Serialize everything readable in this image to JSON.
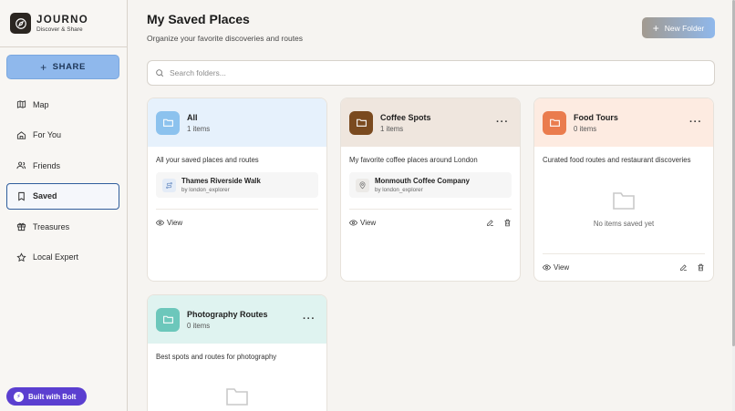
{
  "brand": {
    "name": "JOURNO",
    "tagline": "Discover & Share"
  },
  "sidebar": {
    "share_label": "SHARE",
    "items": [
      {
        "label": "Map",
        "icon": "map-icon"
      },
      {
        "label": "For You",
        "icon": "home-icon"
      },
      {
        "label": "Friends",
        "icon": "users-icon"
      },
      {
        "label": "Saved",
        "icon": "bookmark-icon",
        "active": true
      },
      {
        "label": "Treasures",
        "icon": "gift-icon"
      },
      {
        "label": "Local Expert",
        "icon": "star-icon"
      }
    ],
    "bolt_label": "Built with Bolt"
  },
  "main": {
    "title": "My Saved Places",
    "subtitle": "Organize your favorite discoveries and routes",
    "new_folder_label": "New Folder",
    "search_placeholder": "Search folders..."
  },
  "colors": {
    "all_head": "#e6f1fc",
    "all_icon": "#8cc2ee",
    "coffee_head": "#efe6de",
    "coffee_icon": "#7a4a1f",
    "food_head": "#fdebe1",
    "food_icon": "#ea7c4e",
    "photo_head": "#dff3f0",
    "photo_icon": "#6cc7bb"
  },
  "folders": [
    {
      "name": "All",
      "count": "1 items",
      "description": "All your saved places and routes",
      "item": {
        "title": "Thames Riverside Walk",
        "by": "by london_explorer",
        "icon": "route-icon"
      },
      "view_label": "View"
    },
    {
      "name": "Coffee Spots",
      "count": "1 items",
      "description": "My favorite coffee places around London",
      "item": {
        "title": "Monmouth Coffee Company",
        "by": "by london_explorer",
        "icon": "map-pin-icon"
      },
      "view_label": "View"
    },
    {
      "name": "Food Tours",
      "count": "0 items",
      "description": "Curated food routes and restaurant discoveries",
      "empty_text": "No items saved yet",
      "view_label": "View"
    },
    {
      "name": "Photography Routes",
      "count": "0 items",
      "description": "Best spots and routes for photography"
    }
  ]
}
